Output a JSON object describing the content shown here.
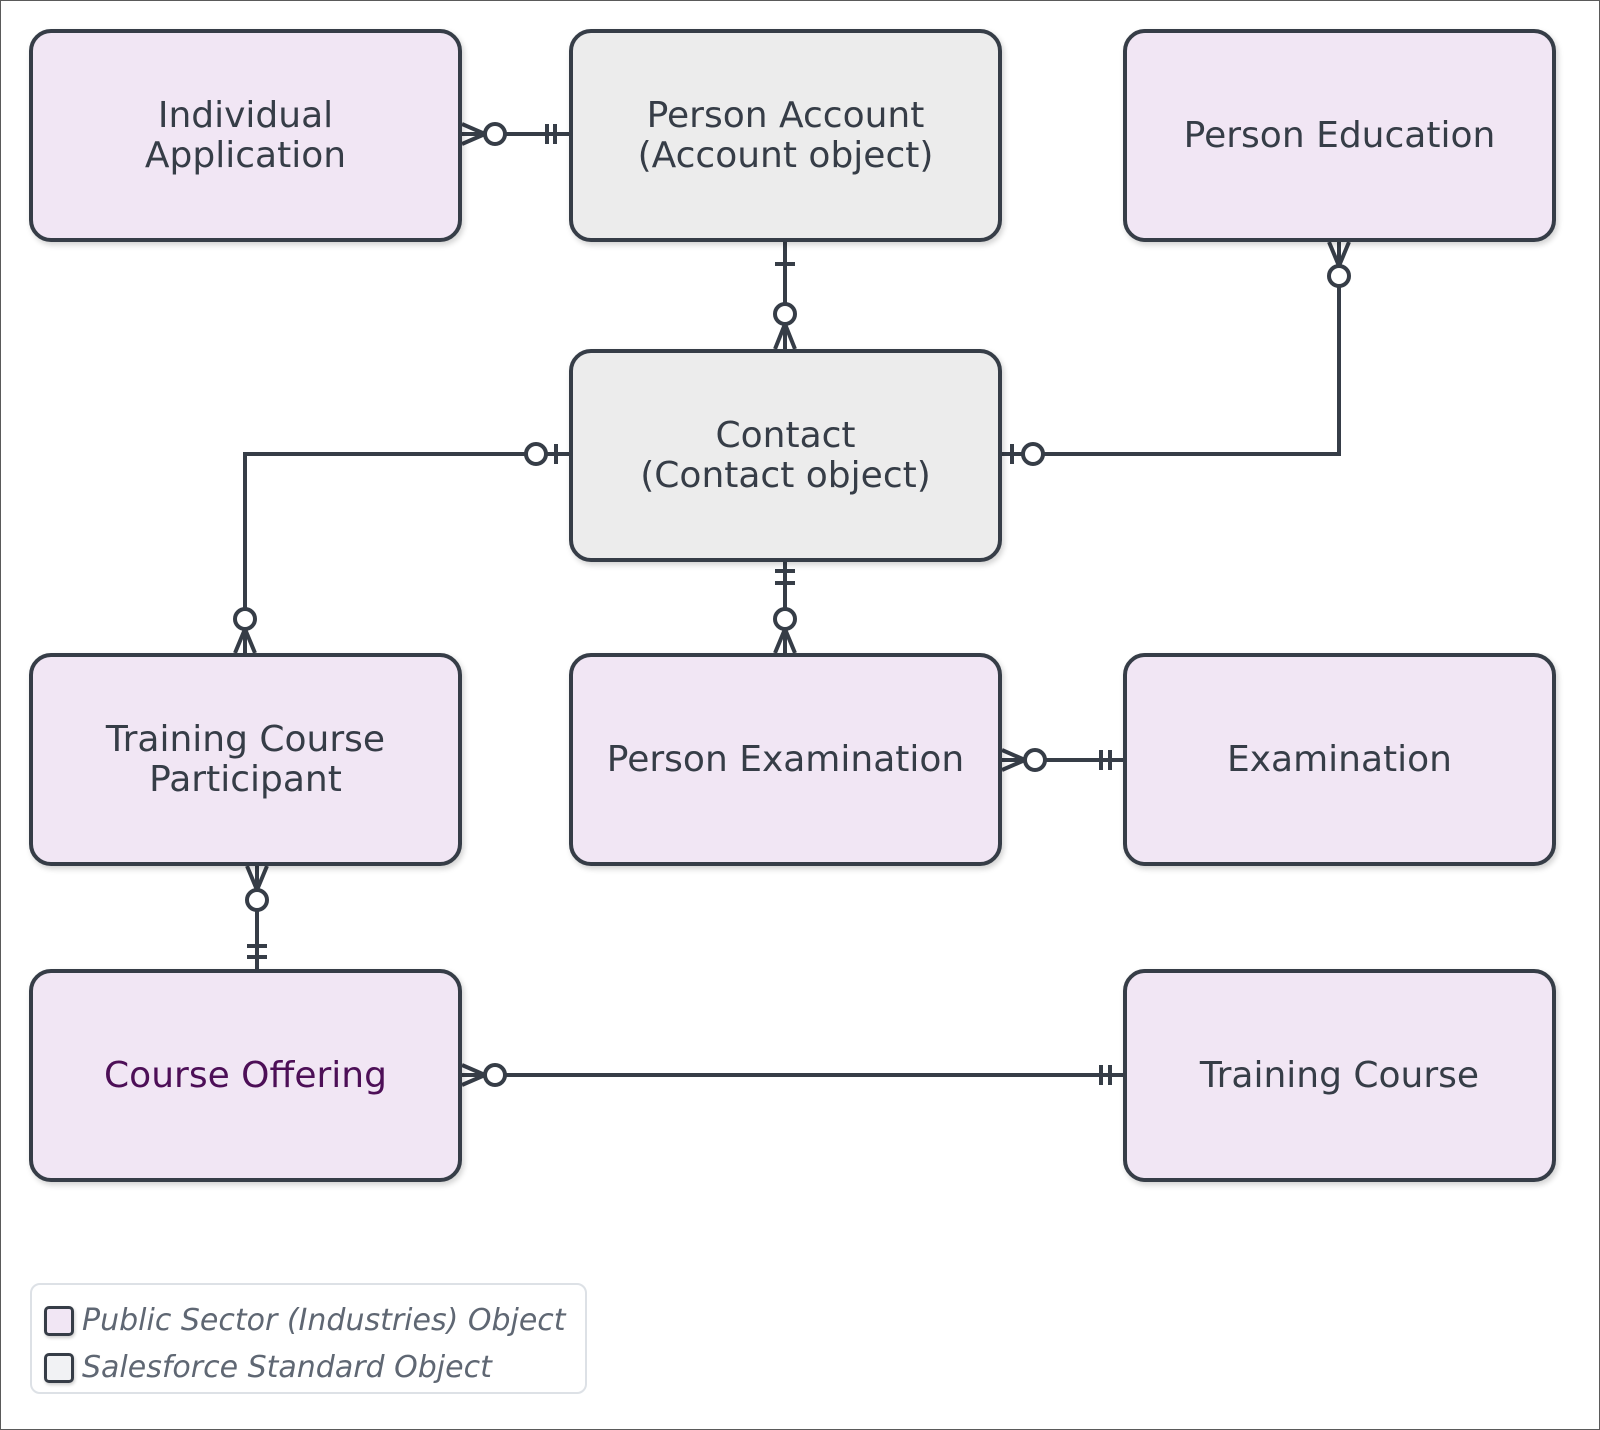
{
  "colors": {
    "stroke": "#363d47",
    "industry_fill": "#f1e6f4",
    "standard_fill": "#ececec",
    "highlight_text": "#4d0f57",
    "legend_text": "#5f6773"
  },
  "entities": [
    {
      "id": "individual-application",
      "label": "Individual\nApplication",
      "kind": "industry"
    },
    {
      "id": "person-account",
      "label": "Person Account\n(Account object)",
      "kind": "standard"
    },
    {
      "id": "person-education",
      "label": "Person Education",
      "kind": "industry"
    },
    {
      "id": "contact",
      "label": "Contact\n(Contact object)",
      "kind": "standard"
    },
    {
      "id": "training-course-participant",
      "label": "Training Course\nParticipant",
      "kind": "industry"
    },
    {
      "id": "person-examination",
      "label": "Person Examination",
      "kind": "industry"
    },
    {
      "id": "examination",
      "label": "Examination",
      "kind": "industry"
    },
    {
      "id": "course-offering",
      "label": "Course Offering",
      "kind": "industry",
      "highlighted": true
    },
    {
      "id": "training-course",
      "label": "Training Course",
      "kind": "industry"
    }
  ],
  "relationships": [
    {
      "from": "individual-application",
      "from_cardinality": "zero-or-many",
      "to": "person-account",
      "to_cardinality": "one-and-only-one"
    },
    {
      "from": "contact",
      "from_cardinality": "zero-or-many",
      "to": "person-account",
      "to_cardinality": "one"
    },
    {
      "from": "person-education",
      "from_cardinality": "zero-or-many",
      "to": "contact",
      "to_cardinality": "zero-or-one"
    },
    {
      "from": "training-course-participant",
      "from_cardinality": "zero-or-many",
      "to": "contact",
      "to_cardinality": "zero-or-one"
    },
    {
      "from": "person-examination",
      "from_cardinality": "zero-or-many",
      "to": "contact",
      "to_cardinality": "one-and-only-one"
    },
    {
      "from": "person-examination",
      "from_cardinality": "zero-or-many",
      "to": "examination",
      "to_cardinality": "one-and-only-one"
    },
    {
      "from": "training-course-participant",
      "from_cardinality": "zero-or-many",
      "to": "course-offering",
      "to_cardinality": "one-and-only-one"
    },
    {
      "from": "course-offering",
      "from_cardinality": "zero-or-many",
      "to": "training-course",
      "to_cardinality": "one-and-only-one"
    }
  ],
  "legend": {
    "items": [
      {
        "label": "Public Sector (Industries) Object",
        "kind": "industry"
      },
      {
        "label": "Salesforce Standard Object",
        "kind": "standard"
      }
    ]
  }
}
